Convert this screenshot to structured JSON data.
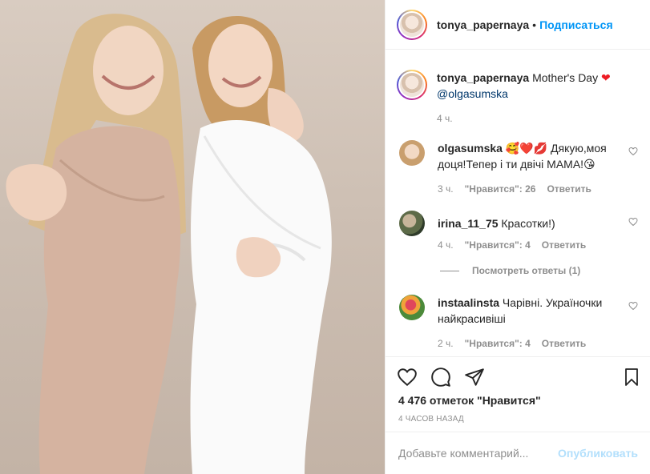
{
  "header": {
    "username": "tonya_papernaya",
    "separator": "•",
    "follow_label": "Подписаться"
  },
  "caption": {
    "username": "tonya_papernaya",
    "text": "Mother's Day",
    "emoji": "❤",
    "mention": "@olgasumska",
    "time": "4 ч."
  },
  "comments": [
    {
      "username": "olgasumska",
      "text": "🥰❤️💋 Дякую,моя доця!Тепер і ти двічі МАМА!😘",
      "time": "3 ч.",
      "likes": "\"Нравится\": 26",
      "reply": "Ответить"
    },
    {
      "username": "irina_11_75",
      "text": "Красотки!)",
      "time": "4 ч.",
      "likes": "\"Нравится\": 4",
      "reply": "Ответить"
    },
    {
      "username": "instaalinsta",
      "text": "Чарівні. Україночки найкрасивіші",
      "time": "2 ч.",
      "likes": "\"Нравится\": 4",
      "reply": "Ответить"
    }
  ],
  "view_replies": "Посмотреть ответы (1)",
  "actions": {
    "icons": [
      "heart-icon",
      "comment-icon",
      "share-icon",
      "bookmark-icon"
    ],
    "likes_text": "4 476 отметок \"Нравится\"",
    "posted_ago": "4 ЧАСОВ НАЗАД"
  },
  "add_comment": {
    "placeholder": "Добавьте комментарий...",
    "post_label": "Опубликовать"
  },
  "colors": {
    "link_blue": "#0095f6",
    "post_disabled": "#b2dffc",
    "muted": "#8e8e8e",
    "text": "#262626"
  }
}
